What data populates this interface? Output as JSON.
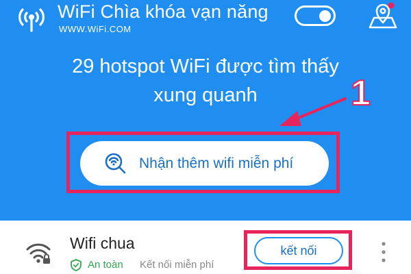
{
  "header": {
    "title": "WiFi Chìa khóa vạn năng",
    "url": "WWW.WiFi.COM",
    "icons": {
      "logo": "wifi-tower-icon",
      "toggle": "toggle-switch",
      "map": "map-pin-icon"
    }
  },
  "hero": {
    "line1": "29 hotspot WiFi được tìm thấy",
    "line2": "xung quanh",
    "annotation": "1",
    "cta_label": "Nhận thêm wifi miễn phí",
    "cta_icon": "search-wifi-icon"
  },
  "network": {
    "name": "Wifi chua",
    "security": "An toàn",
    "note": "Kết nối miễn phí",
    "connect_label": "kết nối",
    "icons": {
      "signal": "wifi-lock-icon",
      "shield": "shield-check-icon",
      "more": "more-vertical-icon"
    }
  },
  "colors": {
    "background": "#1f8ef0",
    "accent": "#1a6fc4",
    "annotation": "#e8245c",
    "safe": "#2fa84f"
  }
}
